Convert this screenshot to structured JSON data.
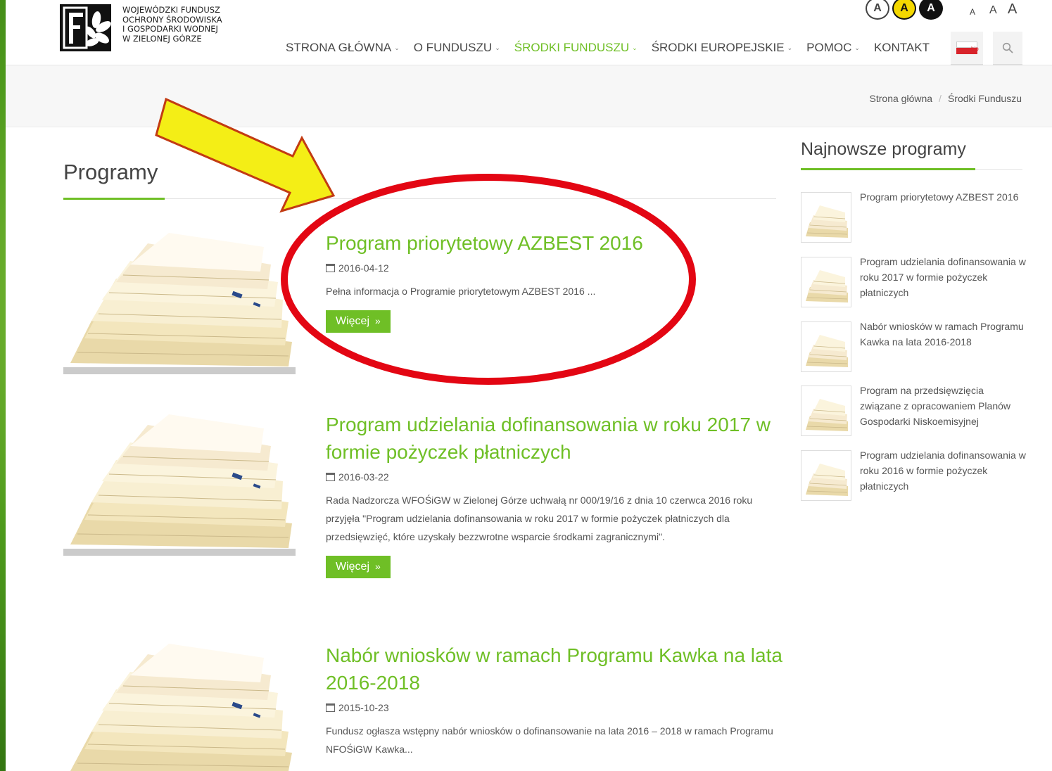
{
  "header": {
    "org_lines": [
      "WOJEWÓDZKI FUNDUSZ",
      "OCHRONY ŚRODOWISKA",
      "I GOSPODARKI WODNEJ",
      "W ZIELONEJ GÓRZE"
    ],
    "contrast_buttons": [
      "A",
      "A",
      "A"
    ],
    "font_size_buttons": [
      "A",
      "A",
      "A"
    ],
    "nav": [
      {
        "label": "STRONA GŁÓWNA",
        "active": false
      },
      {
        "label": "O FUNDUSZU",
        "active": false
      },
      {
        "label": "ŚRODKI FUNDUSZU",
        "active": true
      },
      {
        "label": "ŚRODKI EUROPEJSKIE",
        "active": false
      },
      {
        "label": "POMOC",
        "active": false
      },
      {
        "label": "KONTAKT",
        "active": false
      }
    ],
    "bip_label": "bip",
    "search_icon": "search-icon"
  },
  "breadcrumb": {
    "home": "Strona główna",
    "separator": "/",
    "current": "Środki Funduszu"
  },
  "main": {
    "title": "Programy",
    "posts": [
      {
        "title": "Program priorytetowy AZBEST 2016",
        "date": "2016-04-12",
        "excerpt": "Pełna informacja o Programie priorytetowym AZBEST 2016 ...",
        "more": "Więcej"
      },
      {
        "title": "Program udzielania dofinansowania w roku 2017 w formie pożyczek płatniczych",
        "date": "2016-03-22",
        "excerpt": "Rada Nadzorcza WFOŚiGW w Zielonej Górze uchwałą nr 000/19/16 z dnia 10 czerwca 2016 roku przyjęła \"Program udzielania dofinansowania w roku 2017 w formie pożyczek płatniczych dla przedsięwzięć, które uzyskały bezzwrotne wsparcie środkami zagranicznymi\".",
        "more": "Więcej"
      },
      {
        "title": "Nabór wniosków w ramach Programu Kawka na lata 2016-2018",
        "date": "2015-10-23",
        "excerpt": "Fundusz ogłasza wstępny nabór wniosków o dofinansowanie na lata 2016 – 2018 w ramach Programu NFOŚiGW Kawka...",
        "more": ""
      }
    ]
  },
  "sidebar": {
    "title": "Najnowsze programy",
    "items": [
      "Program priorytetowy AZBEST 2016",
      "Program udzielania dofinansowania w roku 2017 w formie pożyczek płatniczych",
      "Nabór wniosków w ramach Programu Kawka na lata 2016-2018",
      "Program na przedsięwzięcia związane z opracowaniem Planów Gospodarki Niskoemisyjnej",
      "Program udzielania dofinansowania w roku 2016 w formie pożyczek płatniczych"
    ]
  },
  "colors": {
    "accent": "#6fbf26",
    "annotation_red": "#e30613",
    "annotation_arrow": "#f2ee1c"
  }
}
